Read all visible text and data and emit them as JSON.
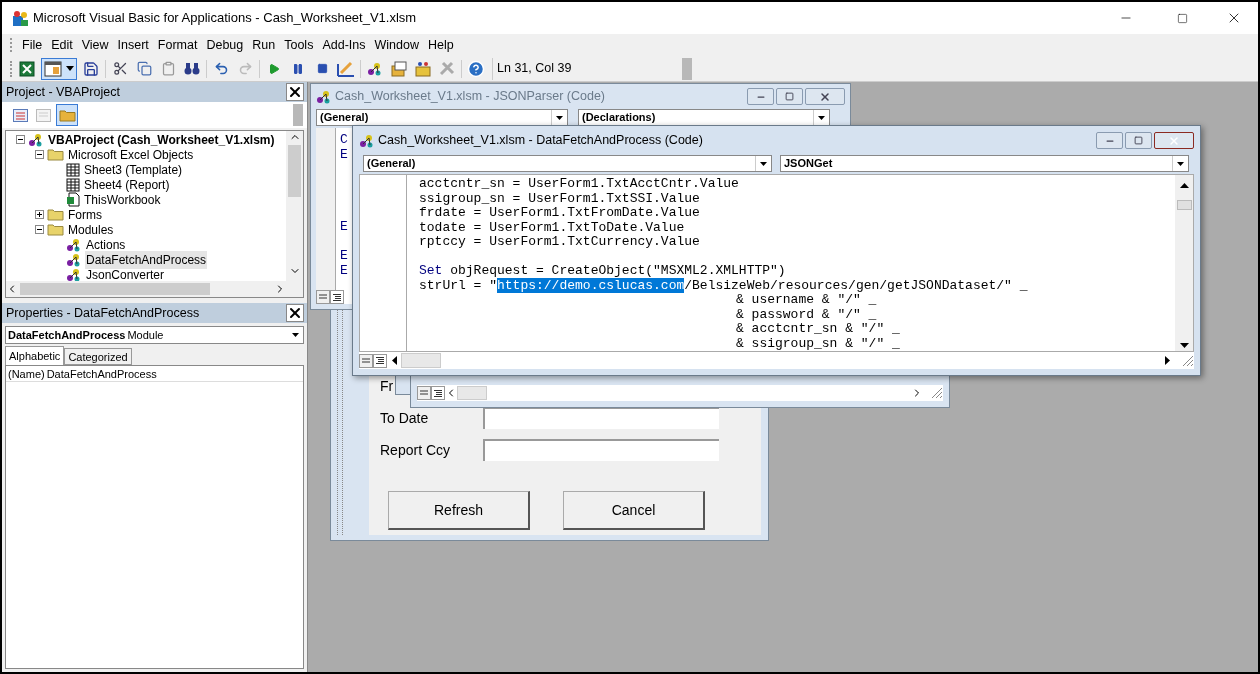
{
  "window": {
    "title": "Microsoft Visual Basic for Applications - Cash_Worksheet_V1.xlsm"
  },
  "menu": [
    "File",
    "Edit",
    "View",
    "Insert",
    "Format",
    "Debug",
    "Run",
    "Tools",
    "Add-Ins",
    "Window",
    "Help"
  ],
  "toolbar": {
    "position": "Ln 31, Col 39"
  },
  "project_pane": {
    "title": "Project - VBAProject",
    "toggle_folders": {
      "selected": true
    },
    "tree": [
      {
        "label": "VBAProject (Cash_Worksheet_V1.xlsm)",
        "kind": "project",
        "expanded": true,
        "selected": false,
        "children": [
          {
            "label": "Microsoft Excel Objects",
            "kind": "folder",
            "expanded": true,
            "selected": false,
            "children": [
              {
                "label": "Sheet3 (Template)",
                "kind": "sheet",
                "selected": false
              },
              {
                "label": "Sheet4 (Report)",
                "kind": "sheet",
                "selected": false
              },
              {
                "label": "ThisWorkbook",
                "kind": "workbook",
                "selected": false
              }
            ]
          },
          {
            "label": "Forms",
            "kind": "folder",
            "expanded": false,
            "selected": false
          },
          {
            "label": "Modules",
            "kind": "folder",
            "expanded": true,
            "selected": false,
            "children": [
              {
                "label": "Actions",
                "kind": "module",
                "selected": false
              },
              {
                "label": "DataFetchAndProcess",
                "kind": "module",
                "selected": true
              },
              {
                "label": "JsonConverter",
                "kind": "module",
                "selected": false
              }
            ]
          }
        ]
      }
    ]
  },
  "properties_pane": {
    "title": "Properties - DataFetchAndProcess",
    "object_name": "DataFetchAndProcess",
    "object_type": "Module",
    "tabs": [
      {
        "label": "Alphabetic",
        "selected": true
      },
      {
        "label": "Categorized",
        "selected": false
      }
    ],
    "rows": [
      {
        "name": "(Name)",
        "value": "DataFetchAndProcess"
      }
    ]
  },
  "user_form": {
    "fields": [
      {
        "label": "Fr"
      },
      {
        "label": "To Date"
      },
      {
        "label": "Report Ccy"
      }
    ],
    "buttons": [
      "Refresh",
      "Cancel"
    ]
  },
  "parser_window": {
    "title": "Cash_Worksheet_V1.xlsm - JSONParser (Code)",
    "object": "(General)",
    "procedure": "(Declarations)",
    "line_starts": [
      "C",
      "E",
      "E",
      "E",
      "E"
    ]
  },
  "code_window": {
    "title": "Cash_Worksheet_V1.xlsm - DataFetchAndProcess (Code)",
    "object": "(General)",
    "procedure": "JSONGet",
    "lines": [
      {
        "kind": "statement",
        "parts": [
          {
            "kind": "plain",
            "text": "acctcntr_sn = UserForm1.TxtAcctCntr.Value"
          }
        ]
      },
      {
        "kind": "statement",
        "parts": [
          {
            "kind": "plain",
            "text": "ssigroup_sn = UserForm1.TxtSSI.Value"
          }
        ]
      },
      {
        "kind": "statement",
        "parts": [
          {
            "kind": "plain",
            "text": "frdate = UserForm1.TxtFromDate.Value"
          }
        ]
      },
      {
        "kind": "statement",
        "parts": [
          {
            "kind": "plain",
            "text": "todate = UserForm1.TxtToDate.Value"
          }
        ]
      },
      {
        "kind": "statement",
        "parts": [
          {
            "kind": "plain",
            "text": "rptccy = UserForm1.TxtCurrency.Value"
          }
        ]
      },
      {
        "kind": "blank"
      },
      {
        "kind": "statement",
        "parts": [
          {
            "kind": "keyword",
            "text": "Set"
          },
          {
            "kind": "plain",
            "text": " objRequest = CreateObject(\"MSXML2.XMLHTTP\")"
          }
        ]
      },
      {
        "kind": "statement",
        "parts": [
          {
            "kind": "plain",
            "text": "strUrl = \""
          },
          {
            "kind": "selected",
            "text": "https://demo.cslucas.com"
          },
          {
            "kind": "plain",
            "text": "/BelsizeWeb/resources/gen/getJSONDataset/\" _"
          }
        ]
      },
      {
        "kind": "continuation",
        "parts": [
          {
            "kind": "plain",
            "text": "& username & \"/\" _"
          }
        ]
      },
      {
        "kind": "continuation",
        "parts": [
          {
            "kind": "plain",
            "text": "& password & \"/\" _"
          }
        ]
      },
      {
        "kind": "continuation",
        "parts": [
          {
            "kind": "plain",
            "text": "& acctcntr_sn & \"/\" _"
          }
        ]
      },
      {
        "kind": "continuation",
        "parts": [
          {
            "kind": "plain",
            "text": "& ssigroup_sn & \"/\" _"
          }
        ]
      }
    ]
  }
}
